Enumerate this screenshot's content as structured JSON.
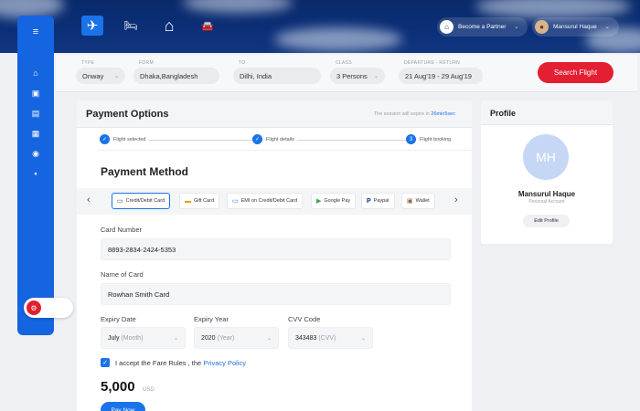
{
  "header": {
    "nav": [
      {
        "name": "flight",
        "icon": "plane-icon",
        "glyph": "✈",
        "active": true
      },
      {
        "name": "hotel",
        "icon": "bed-icon",
        "glyph": "🛏",
        "active": false
      },
      {
        "name": "home",
        "icon": "home-icon",
        "glyph": "⌂",
        "active": false
      },
      {
        "name": "car",
        "icon": "car-icon",
        "glyph": "🚘",
        "active": false
      }
    ],
    "partner_label": "Become a Partner",
    "user_name": "Mansurul Haque"
  },
  "sidebar": {
    "menu_icon": "≡",
    "items": [
      "home-icon",
      "calendar-icon",
      "document-icon",
      "briefcase-icon",
      "globe-icon",
      "info-icon"
    ]
  },
  "search": {
    "type": {
      "label": "TYPE",
      "value": "Onway"
    },
    "from": {
      "label": "FORM",
      "value": "Dhaka,Bangladesh"
    },
    "to": {
      "label": "TO",
      "value": "Dilhi, India"
    },
    "class": {
      "label": "CLASS",
      "value": "3 Persons"
    },
    "dates": {
      "label": "DEPARTURE - RETURN",
      "value": "21 Aug'19 - 29 Aug'19"
    },
    "button": "Search  Flight"
  },
  "payment": {
    "title": "Payment Options",
    "session_text": "The session will expire in",
    "session_time": "26min5sec",
    "steps": [
      "Flight selected",
      "Flight details",
      "Flight booking"
    ],
    "step3_number": "3",
    "method_title": "Payment Method",
    "methods": [
      "Credit/Debit Card",
      "Gift Card",
      "EMI on Credit/Debit Card",
      "Google Pay",
      "Paypal",
      "Wallet"
    ],
    "card_number_label": "Card Number",
    "card_number": "8893-2834-2424-5353",
    "name_label": "Name of Card",
    "name_value": "Rowhan Smith Card",
    "expiry_date_label": "Expiry Date",
    "expiry_date_value": "July",
    "expiry_date_hint": "(Month)",
    "expiry_year_label": "Expiry Year",
    "expiry_year_value": "2020",
    "expiry_year_hint": "(Year)",
    "cvv_label": "CVV Code",
    "cvv_value": "343483",
    "cvv_hint": "(CVV)",
    "accept_text": "I accept the Fare Rules , the",
    "privacy_link": "Privacy Policy",
    "amount": "5,000",
    "currency": "USD",
    "pay_button": "Pay Now"
  },
  "profile": {
    "title": "Profile",
    "initials": "MH",
    "name": "Mansurul Haque",
    "role": "Personal Account",
    "edit_button": "Edit Profile"
  }
}
